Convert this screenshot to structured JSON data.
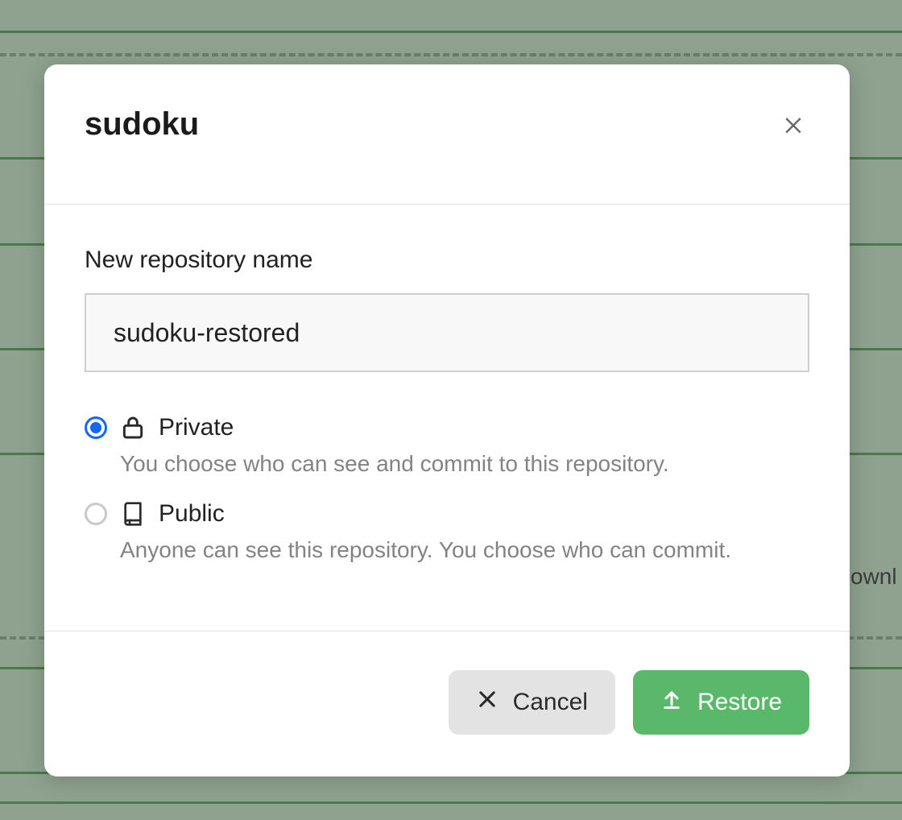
{
  "modal": {
    "title": "sudoku",
    "repo_name_label": "New repository name",
    "repo_name_value": "sudoku-restored",
    "visibility": {
      "private": {
        "label": "Private",
        "description": "You choose who can see and commit to this repository.",
        "selected": true
      },
      "public": {
        "label": "Public",
        "description": "Anyone can see this repository. You choose who can commit.",
        "selected": false
      }
    },
    "buttons": {
      "cancel": "Cancel",
      "restore": "Restore"
    }
  },
  "background": {
    "partial_text": "ownl"
  }
}
